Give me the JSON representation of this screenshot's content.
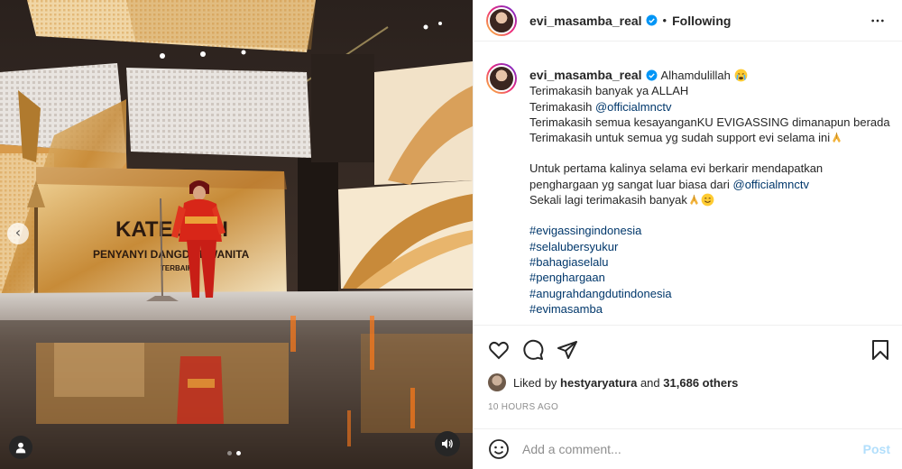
{
  "post": {
    "username": "evi_masamba_real",
    "separator": "•",
    "follow_state": "Following",
    "more_icon": "more-horizontal-icon"
  },
  "caption": {
    "username": "evi_masamba_real",
    "first_line": "Alhamdulillah",
    "line2": "Terimakasih banyak ya ALLAH",
    "line3_prefix": "Terimakasih ",
    "mention1": "@officialmnctv",
    "line4": "Terimakasih semua kesayanganKU EVIGASSING dimanapun berada",
    "line5": "Terimakasih untuk semua yg sudah support evi selama ini",
    "line6": "Untuk pertama kalinya selama evi berkarir mendapatkan",
    "line7_prefix": "penghargaan yg sangat luar biasa dari ",
    "mention2": "@officialmnctv",
    "line8": "Sekali lagi terimakasih banyak",
    "hashtags": [
      "#evigassingindonesia",
      "#selalubersyukur",
      "#bahagiaselalu",
      "#penghargaan",
      "#anugrahdangdutindonesia",
      "#evimasamba"
    ]
  },
  "media": {
    "stage_sign_title": "KATEGORI",
    "stage_sign_sub": "PENYANYI DANGDUT WANITA",
    "stage_sign_sub2": "TERBAIK",
    "carousel_count": 2,
    "carousel_active": 2
  },
  "engagement": {
    "liked_prefix": "Liked by ",
    "liked_user": "hestyaryatura",
    "liked_and": " and ",
    "others": "31,686 others",
    "time": "10 HOURS AGO"
  },
  "comment": {
    "placeholder": "Add a comment...",
    "post_label": "Post"
  },
  "colors": {
    "link": "#00376b",
    "verified": "#0095f6",
    "post_disabled": "#b2dffc"
  }
}
